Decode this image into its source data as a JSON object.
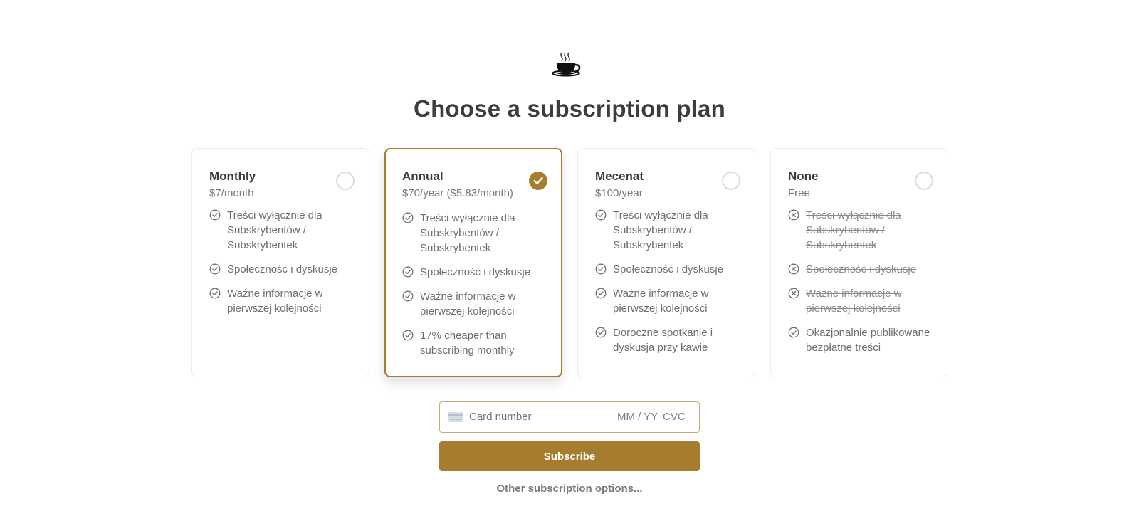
{
  "header": {
    "logo_icon": "coffee-cup-icon",
    "title": "Choose a subscription plan"
  },
  "accent_color": "#a67c2f",
  "plans": [
    {
      "name": "Monthly",
      "price": "$7/month",
      "selected": false,
      "features": [
        {
          "text": "Treści wyłącznie dla Subskrybentów / Subskrybentek",
          "included": true
        },
        {
          "text": "Społeczność i dyskusje",
          "included": true
        },
        {
          "text": "Ważne informacje w pierwszej kolejności",
          "included": true
        }
      ]
    },
    {
      "name": "Annual",
      "price": "$70/year ($5.83/month)",
      "selected": true,
      "features": [
        {
          "text": "Treści wyłącznie dla Subskrybentów / Subskrybentek",
          "included": true
        },
        {
          "text": "Społeczność i dyskusje",
          "included": true
        },
        {
          "text": "Ważne informacje w pierwszej kolejności",
          "included": true
        },
        {
          "text": "17% cheaper than subscribing monthly",
          "included": true
        }
      ]
    },
    {
      "name": "Mecenat",
      "price": "$100/year",
      "selected": false,
      "features": [
        {
          "text": "Treści wyłącznie dla Subskrybentów / Subskrybentek",
          "included": true
        },
        {
          "text": "Społeczność i dyskusje",
          "included": true
        },
        {
          "text": "Ważne informacje w pierwszej kolejności",
          "included": true
        },
        {
          "text": "Doroczne spotkanie i dyskusja przy kawie",
          "included": true
        }
      ]
    },
    {
      "name": "None",
      "price": "Free",
      "selected": false,
      "features": [
        {
          "text": "Treści wyłącznie dla Subskrybentów / Subskrybentek",
          "included": false
        },
        {
          "text": "Społeczność i dyskusje",
          "included": false
        },
        {
          "text": "Ważne informacje w pierwszej kolejności",
          "included": false
        },
        {
          "text": "Okazjonalnie publikowane bezpłatne treści",
          "included": true
        }
      ]
    }
  ],
  "payment": {
    "card_icon": "credit-card-icon",
    "card_number_placeholder": "Card number",
    "expiry_placeholder": "MM / YY",
    "cvc_placeholder": "CVC"
  },
  "actions": {
    "subscribe_label": "Subscribe",
    "other_options_label": "Other subscription options..."
  }
}
